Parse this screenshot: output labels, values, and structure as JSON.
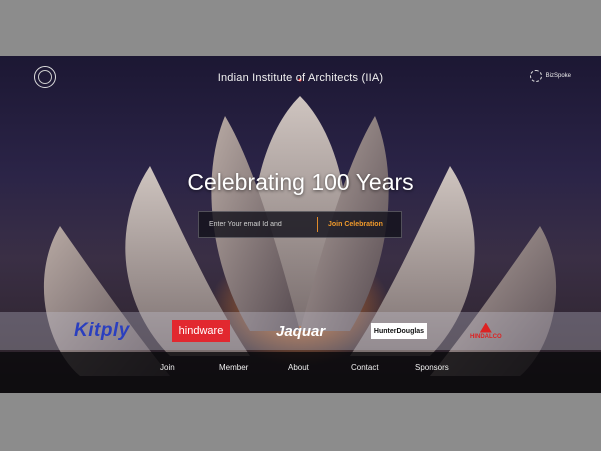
{
  "header": {
    "title": "Indian Institute of Architects (IIA)",
    "logo_icon": "iia-emblem-icon",
    "brand_name": "BizSpoke",
    "brand_icon": "gear-icon"
  },
  "hero": {
    "heading": "Celebrating 100 Years",
    "email_placeholder": "Enter Your email Id and",
    "cta_label": "Join Celebration"
  },
  "sponsors": [
    {
      "name": "Kitply"
    },
    {
      "name": "hindware"
    },
    {
      "name": "Jaquar"
    },
    {
      "name": "HunterDouglas"
    },
    {
      "name": "HINDALCO"
    }
  ],
  "footer": {
    "links": [
      "Join",
      "Member",
      "About",
      "Contact",
      "Sponsors"
    ]
  },
  "colors": {
    "accent": "#f09a2b",
    "hindware": "#e2282f",
    "kitply": "#2a3fbf"
  }
}
